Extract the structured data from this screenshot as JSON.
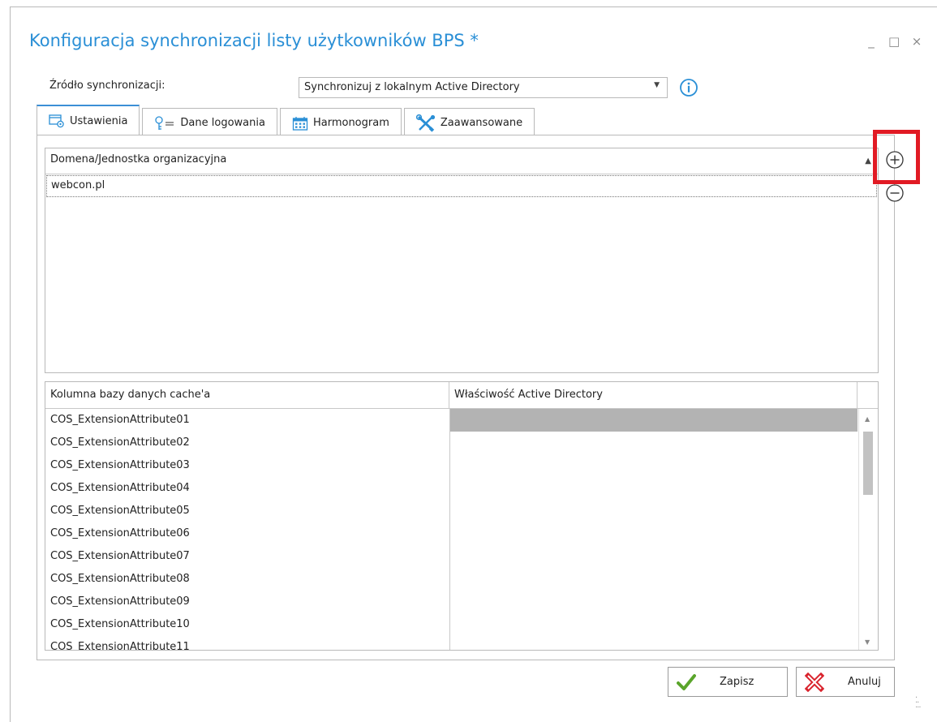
{
  "window": {
    "title": "Konfiguracja synchronizacji listy użytkowników BPS *",
    "controls": {
      "minimize": "_",
      "maximize": "□",
      "close": "×"
    }
  },
  "source": {
    "label": "Źródło synchronizacji:",
    "selected": "Synchronizuj z lokalnym Active Directory"
  },
  "tabs": [
    {
      "label": "Ustawienia",
      "icon": "settings-form-icon",
      "active": true
    },
    {
      "label": "Dane logowania",
      "icon": "key-icon",
      "active": false
    },
    {
      "label": "Harmonogram",
      "icon": "calendar-icon",
      "active": false
    },
    {
      "label": "Zaawansowane",
      "icon": "tools-icon",
      "active": false
    }
  ],
  "domains_grid": {
    "header": "Domena/Jednostka organizacyjna",
    "rows": [
      "webcon.pl"
    ]
  },
  "mapping_grid": {
    "columns": [
      "Kolumna bazy danych cache'a",
      "Właściwość Active Directory"
    ],
    "rows": [
      "COS_ExtensionAttribute01",
      "COS_ExtensionAttribute02",
      "COS_ExtensionAttribute03",
      "COS_ExtensionAttribute04",
      "COS_ExtensionAttribute05",
      "COS_ExtensionAttribute06",
      "COS_ExtensionAttribute07",
      "COS_ExtensionAttribute08",
      "COS_ExtensionAttribute09",
      "COS_ExtensionAttribute10",
      "COS_ExtensionAttribute11"
    ]
  },
  "buttons": {
    "save": "Zapisz",
    "cancel": "Anuluj"
  },
  "colors": {
    "title": "#2a8fd6",
    "highlight": "#e11a24",
    "save_check": "#5aa52b",
    "cancel_x": "#d9232d"
  }
}
